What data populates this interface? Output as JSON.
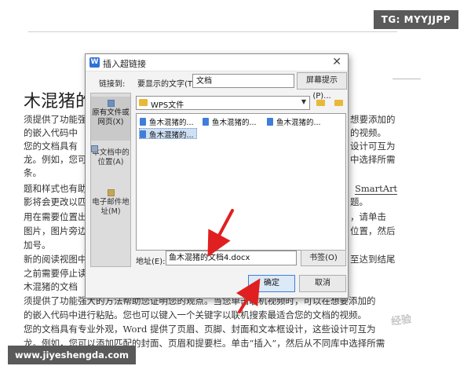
{
  "document": {
    "heading": "木混猪的",
    "lines_left": [
      {
        "text": "须提供了功能强"
      },
      {
        "text": "的嵌入代码中"
      },
      {
        "text": "您的文档具有"
      },
      {
        "text": "龙。例如，您可"
      },
      {
        "text": "条。"
      },
      {
        "text": "题和样式也有助"
      },
      {
        "text": "影将会更改以匹"
      },
      {
        "text": "用在需要位置出"
      },
      {
        "text": "图片，图片旁边"
      },
      {
        "text": "加号。"
      },
      {
        "text": "新的阅读视图中"
      },
      {
        "text": "之前需要停止读"
      },
      {
        "text": "木混猪的文档"
      }
    ],
    "lines_right": [
      {
        "text": "想要添加的"
      },
      {
        "text": "的视频。"
      },
      {
        "text": "设计可互为"
      },
      {
        "text": "中选择所需"
      },
      {
        "text": "",
        "smart": "SmartArt"
      },
      {
        "text": "题。"
      },
      {
        "text": "，请单击"
      },
      {
        "text": "位置，然后"
      },
      {
        "text": ""
      },
      {
        "text": ""
      },
      {
        "text": "至达到结尾"
      }
    ],
    "lines_full": [
      "须提供了功能强大的方法帮助您证明您的观点。当您单击联机视频时，可以在想要添加的",
      "的嵌入代码中进行粘贴。您也可以键入一个关键字以联机搜索最适合您的文档的视频。",
      "您的文档具有专业外观，Word 提供了页眉、页脚、封面和文本框设计，这些设计可互为",
      "龙。例如，您可以添加匹配的封面、页眉和提要栏。单击“插入”，然后从不同库中选择所需"
    ]
  },
  "watermarks": {
    "top": "TG: MYYJJPP",
    "bottom": "www.jiyeshengda.com",
    "ghost": "经验"
  },
  "dialog": {
    "title": "插入超链接",
    "title_icon": "W",
    "link_to_label": "链接到:",
    "display_text_label": "要显示的文字(T):",
    "display_text_value": "文档",
    "screen_tip_label": "屏幕提示(P)...",
    "nav": [
      {
        "label": "原有文件或网页(X)",
        "icon": "web-file-icon",
        "selected": true
      },
      {
        "label": "本文档中的位置(A)",
        "icon": "document-place-icon",
        "selected": false
      },
      {
        "label": "电子邮件地址(M)",
        "icon": "email-icon",
        "selected": false
      }
    ],
    "folder": "WPS文件",
    "files": [
      {
        "name": "鱼木混猪的..."
      },
      {
        "name": "鱼木混猪的..."
      },
      {
        "name": "鱼木混猪的..."
      },
      {
        "name": "鱼木混猪的...",
        "selected": true
      }
    ],
    "address_label": "地址(E):",
    "address_value": "鱼木混猪的文档4.docx",
    "bookmark_label": "书签(O)",
    "ok_label": "确定",
    "cancel_label": "取消"
  },
  "colors": {
    "accent": "#3f7fd9",
    "arrow": "#e02020"
  }
}
